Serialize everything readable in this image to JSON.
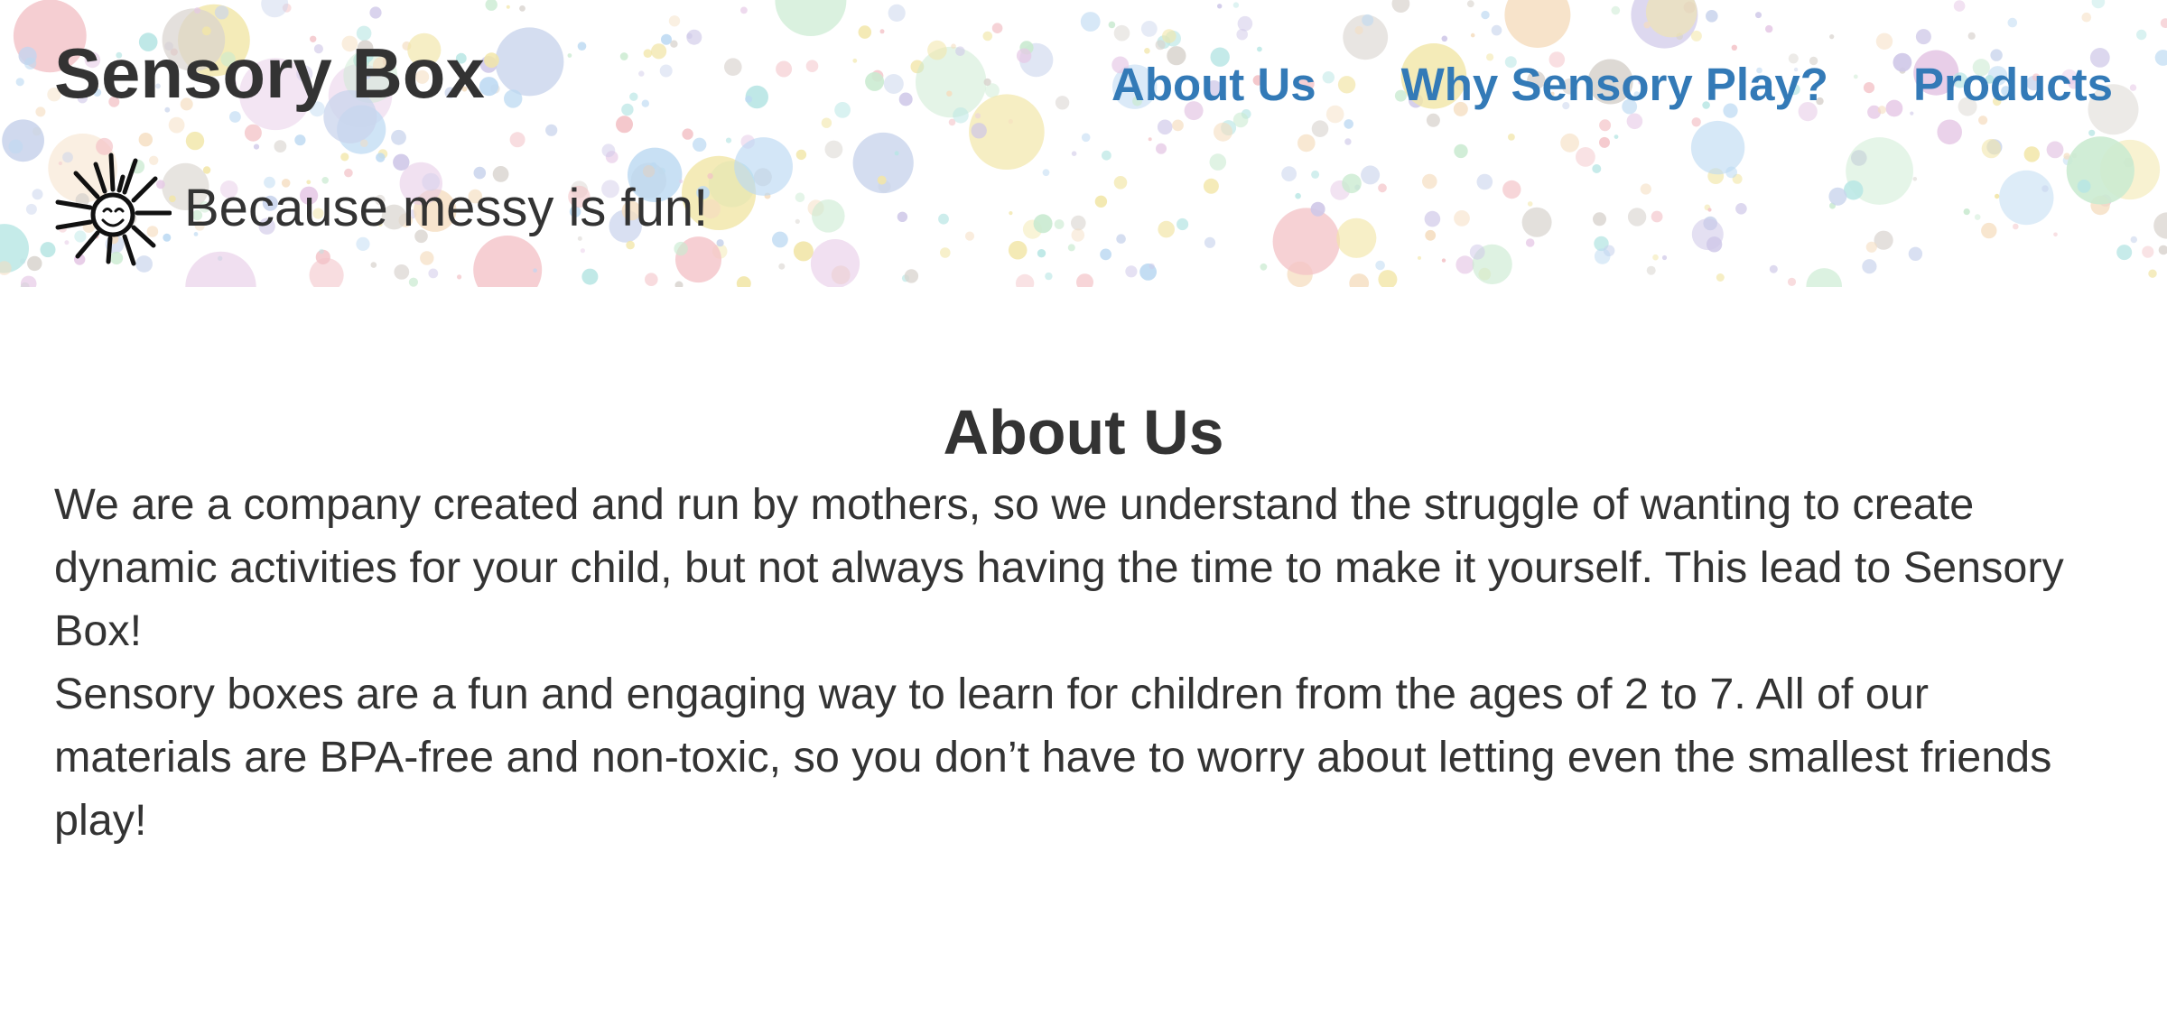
{
  "site": {
    "title": "Sensory Box",
    "tagline": "Because messy is fun!",
    "logo_icon": "smiling-sun-icon"
  },
  "nav": {
    "items": [
      {
        "label": "About Us"
      },
      {
        "label": "Why Sensory Play?"
      },
      {
        "label": "Products"
      }
    ]
  },
  "main": {
    "heading": "About Us",
    "paragraphs": [
      "We are a company created and run by mothers, so we understand the struggle of wanting to create dynamic activities for your child, but not always having the time to make it yourself. This lead to Sensory Box!",
      "Sensory boxes are a fun and engaging way to learn for children from the ages of 2 to 7. All of our materials are BPA-free and non-toxic, so you don’t have to worry about letting even the smallest friends play!"
    ]
  },
  "colors": {
    "text": "#333333",
    "link": "#337ab7",
    "background": "#ffffff",
    "confetti_palette": [
      "#b8e6e4",
      "#e6c9e6",
      "#f2e6a8",
      "#c9d4ec",
      "#f3c2c7",
      "#d9d4cf",
      "#c9ead0",
      "#f5ddbf",
      "#bcd9f2",
      "#cfc8e8"
    ]
  }
}
